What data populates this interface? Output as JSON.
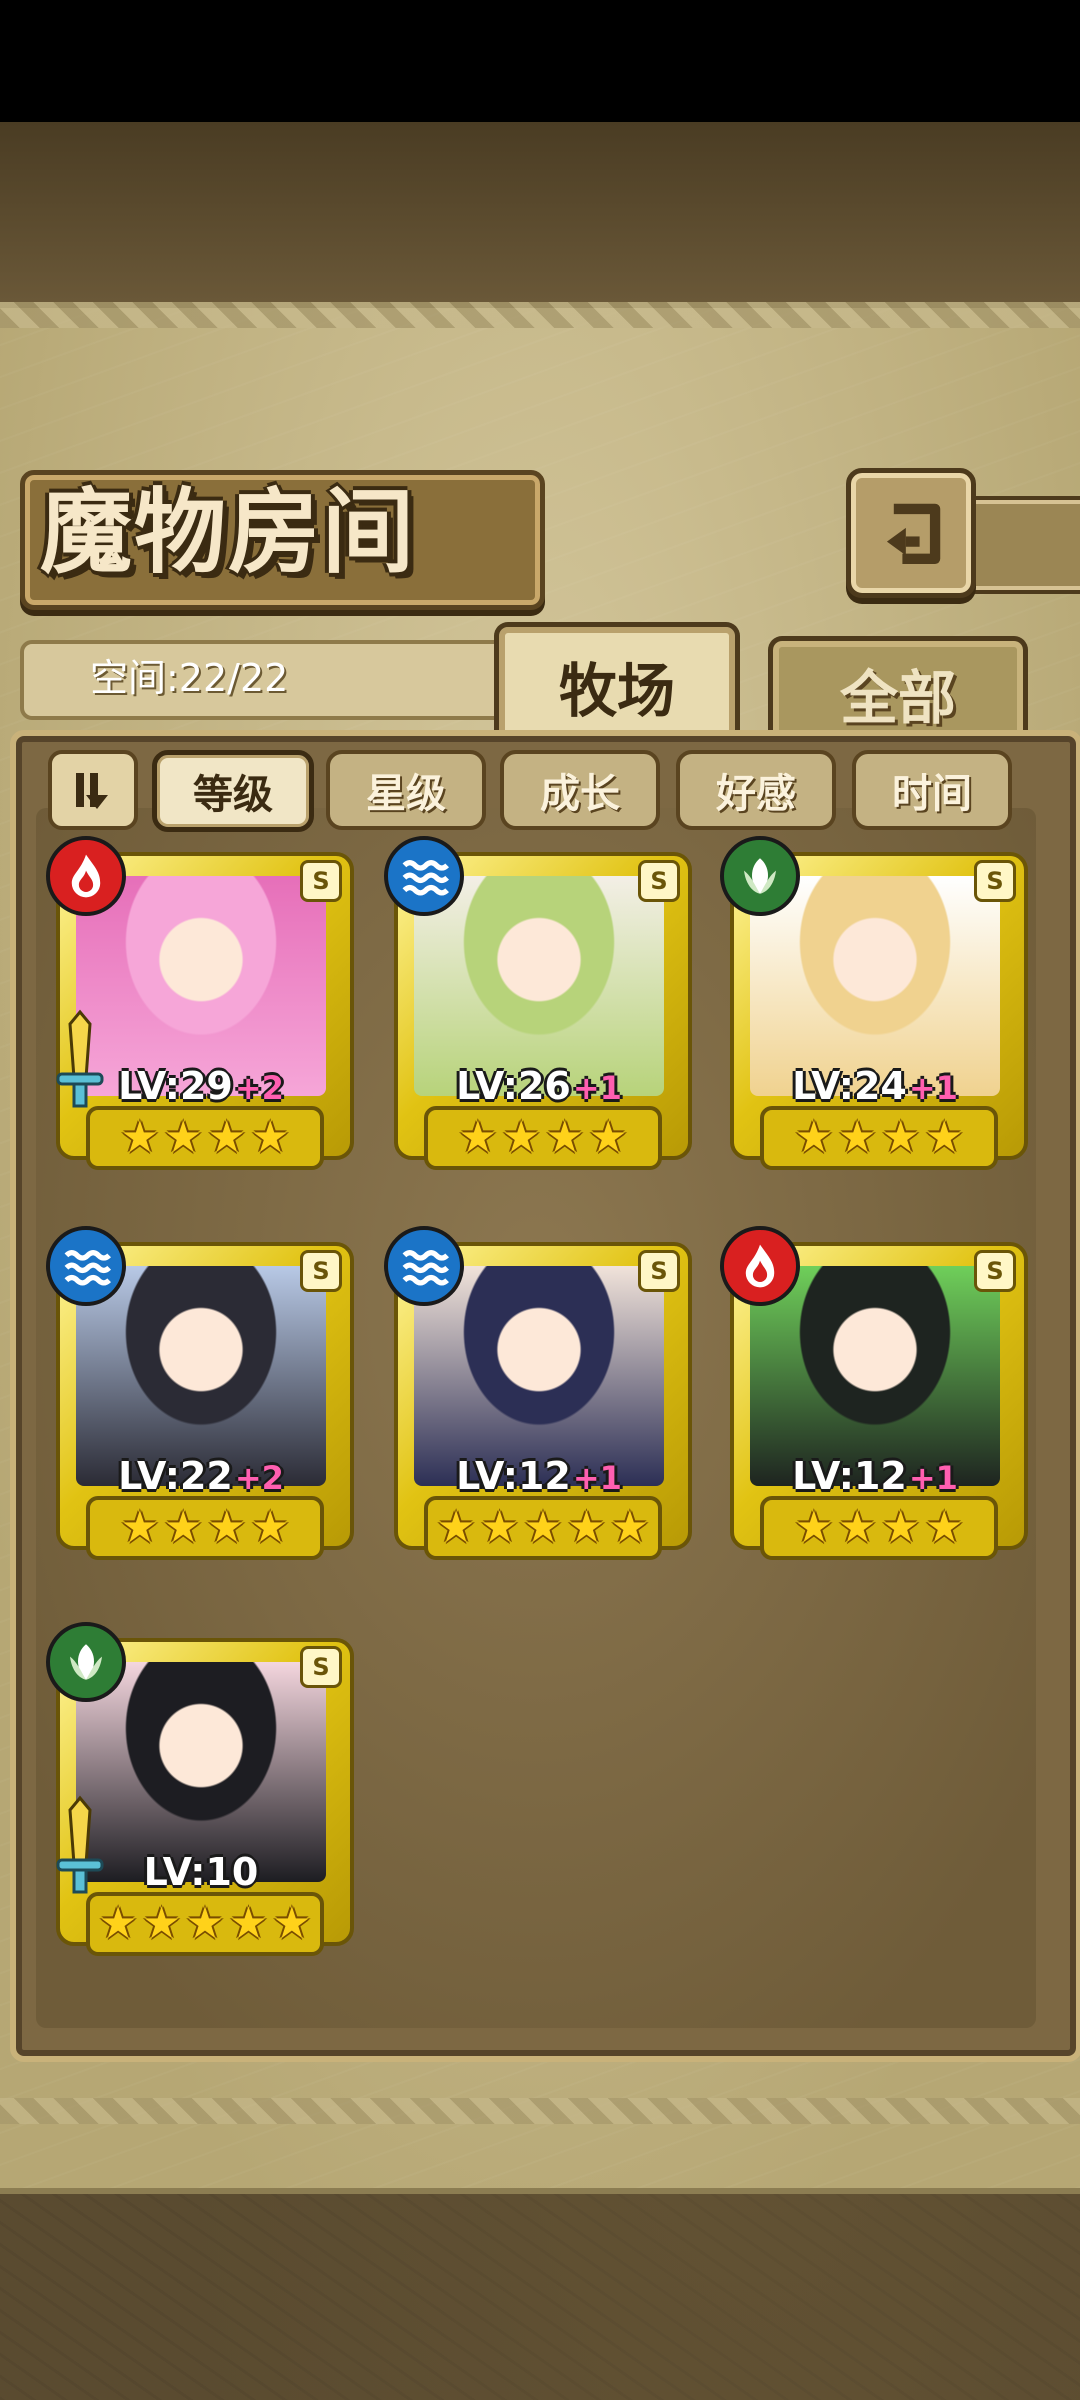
{
  "header": {
    "title": "魔物房间"
  },
  "space": {
    "label": "空间:22/22"
  },
  "tabs": [
    {
      "label": "牧场",
      "active": true
    },
    {
      "label": "全部",
      "active": false
    }
  ],
  "sort": {
    "selected": "等级",
    "options": [
      "等级",
      "星级",
      "成长",
      "好感",
      "时间"
    ]
  },
  "cards": [
    {
      "element": "fire",
      "level": "LV:29",
      "bonus": "+2",
      "stars": 4,
      "rarity": "S",
      "weapon": true,
      "palette": [
        "#f6a6d8",
        "#e66fb9"
      ]
    },
    {
      "element": "water",
      "level": "LV:26",
      "bonus": "+1",
      "stars": 4,
      "rarity": "S",
      "weapon": false,
      "palette": [
        "#b7d37a",
        "#f3efe6"
      ]
    },
    {
      "element": "wood",
      "level": "LV:24",
      "bonus": "+1",
      "stars": 4,
      "rarity": "S",
      "weapon": false,
      "palette": [
        "#f0d28f",
        "#ffffff"
      ]
    },
    {
      "element": "water",
      "level": "LV:22",
      "bonus": "+2",
      "stars": 4,
      "rarity": "S",
      "weapon": false,
      "palette": [
        "#2b2b35",
        "#b8c9e6"
      ]
    },
    {
      "element": "water",
      "level": "LV:12",
      "bonus": "+1",
      "stars": 5,
      "rarity": "S",
      "weapon": false,
      "palette": [
        "#2c2f55",
        "#f1e3da"
      ]
    },
    {
      "element": "fire",
      "level": "LV:12",
      "bonus": "+1",
      "stars": 4,
      "rarity": "S",
      "weapon": false,
      "palette": [
        "#1e2420",
        "#6fcf5a"
      ]
    },
    {
      "element": "wood",
      "level": "LV:10",
      "bonus": "",
      "stars": 5,
      "rarity": "S",
      "weapon": true,
      "palette": [
        "#1d1d22",
        "#f4d6de"
      ]
    }
  ],
  "icons": {
    "back": "back-arrow-icon",
    "sort": "sort-order-icon"
  }
}
